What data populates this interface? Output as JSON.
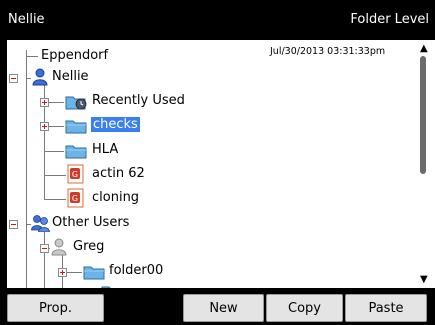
{
  "titlebar": {
    "left": "Nellie",
    "right": "Folder Level"
  },
  "timestamp": "Jul/30/2013 03:31:33pm",
  "tree": {
    "root": "Eppendorf",
    "nellie": "Nellie",
    "recently_used": "Recently Used",
    "checks": "checks",
    "hla": "HLA",
    "actin": "actin 62",
    "cloning": "cloning",
    "other_users": "Other Users",
    "greg": "Greg",
    "folder00": "folder00"
  },
  "buttons": {
    "prop": "Prop.",
    "new": "New",
    "copy": "Copy",
    "paste": "Paste"
  },
  "colors": {
    "selection": "#3a7ff0",
    "folder": "#6cb3e8",
    "expander_plus": "#dd1111"
  }
}
